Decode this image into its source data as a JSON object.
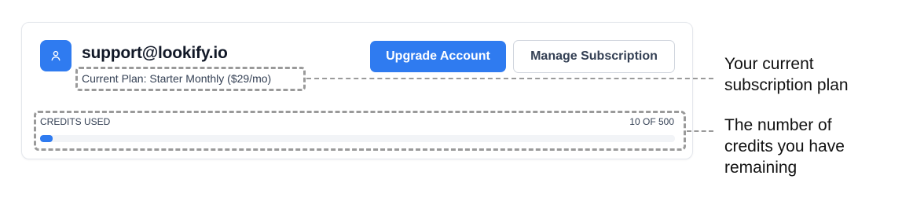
{
  "account": {
    "email": "support@lookify.io",
    "plan_text": "Current Plan: Starter Monthly ($29/mo)",
    "avatar_icon": "user-icon"
  },
  "actions": {
    "upgrade_label": "Upgrade Account",
    "manage_label": "Manage Subscription"
  },
  "credits": {
    "label": "CREDITS USED",
    "count_text": "10 OF 500",
    "used": 10,
    "total": 500
  },
  "annotations": {
    "plan_lines": [
      "Your current",
      "subscription plan"
    ],
    "credits_lines": [
      "The number of",
      "credits you have",
      "remaining"
    ]
  },
  "colors": {
    "accent": "#2f7bf0",
    "dash": "#9a9a9a"
  }
}
